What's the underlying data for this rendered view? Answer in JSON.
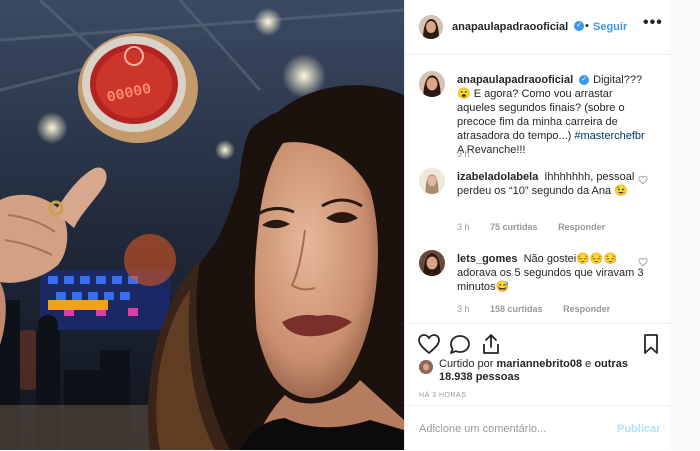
{
  "post": {
    "author": {
      "username": "anapaulapadraooficial",
      "verified": true,
      "avatar_icon": "profile-photo"
    },
    "follow_label": "Seguir",
    "more_label": "•••",
    "caption": {
      "username": "anapaulapadraooficial",
      "text": "Digital??? 😮 E agora? Como vou arrastar aqueles segundos finais? (sobre o precoce fim da minha carreira de atrasadora do tempo...) ",
      "hashtag": "#masterchefbr",
      "suffix": " A Revanche!!!",
      "time": "3 h"
    },
    "comments": [
      {
        "username": "izabeladolabela",
        "text": "Ihhhhhhh, pessoal perdeu os “10” segundo da Ana 😉",
        "time": "3 h",
        "likes": "75 curtidas",
        "reply": "Responder"
      },
      {
        "username": "lets_gomes",
        "text": "Não gostei😔😔😔 adorava os 5 segundos que viravam 3 minutos😅",
        "time": "3 h",
        "likes": "158 curtidas",
        "reply": "Responder"
      }
    ],
    "liked_by": {
      "prefix": "Curtido por ",
      "user": "mariannebrito08",
      "middle": " e ",
      "others": "outras 18.938 pessoas"
    },
    "time_ago": "HÁ 3 HORAS",
    "comment_placeholder": "Adicione um comentário...",
    "publish_label": "Publicar",
    "photo": {
      "sign_text": "00000"
    }
  },
  "colors": {
    "accent": "#3897f0",
    "publish_disabled": "#b2dffc",
    "text": "#262626",
    "muted": "#999999",
    "hashtag": "#003569"
  }
}
